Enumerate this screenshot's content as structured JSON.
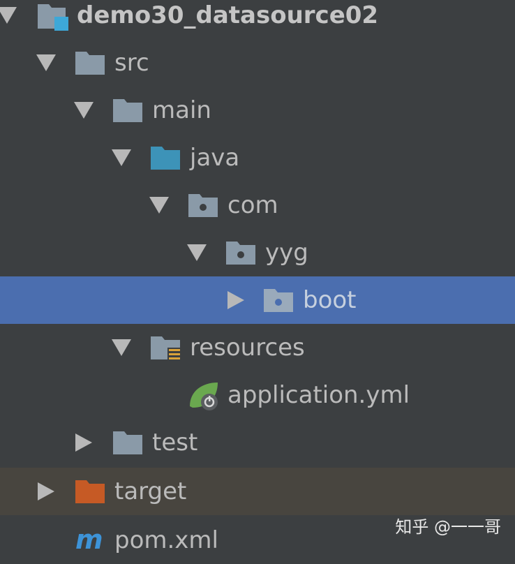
{
  "tree": {
    "items": [
      {
        "label": "demo30_datasource02"
      },
      {
        "label": "src"
      },
      {
        "label": "main"
      },
      {
        "label": "java"
      },
      {
        "label": "com"
      },
      {
        "label": "yyg"
      },
      {
        "label": "boot"
      },
      {
        "label": "resources"
      },
      {
        "label": "application.yml"
      },
      {
        "label": "test"
      },
      {
        "label": "target"
      },
      {
        "label": "pom.xml"
      }
    ]
  },
  "icons": {
    "folder_color": "#8a9aa8",
    "source_folder_color": "#3d93b8",
    "excluded_folder_color": "#c65a25",
    "module_badge_color": "#3da8d8",
    "spring_leaf_color": "#6aa84f",
    "maven_color": "#3d93d8",
    "selection_color": "#4b6eaf"
  },
  "watermark": "知乎 @一一哥"
}
